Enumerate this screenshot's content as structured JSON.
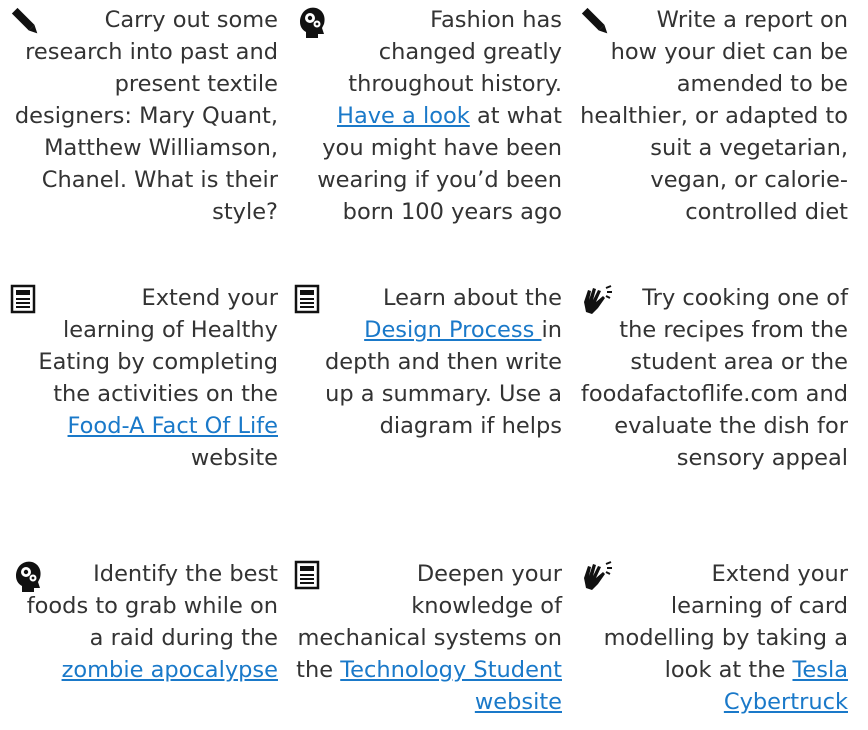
{
  "tiles": [
    {
      "icon": "pencil-icon",
      "parts": [
        {
          "text": "Carry out some research into past and present textile designers: Mary Quant, Matthew Williamson, Chanel. What is their style?"
        }
      ]
    },
    {
      "icon": "head-gears-icon",
      "parts": [
        {
          "text": "Fashion has changed greatly throughout history. "
        },
        {
          "text": "Have a look",
          "link": true
        },
        {
          "text": " at what you might have been wearing if you’d been born 100 years ago"
        }
      ]
    },
    {
      "icon": "pencil-icon",
      "parts": [
        {
          "text": "Write a report on how your diet can be amended to be healthier, or adapted to suit a vegetarian, vegan, or calorie-controlled diet"
        }
      ]
    },
    {
      "icon": "newspaper-icon",
      "parts": [
        {
          "text": "Extend your learning of Healthy Eating by completing the activities on the "
        },
        {
          "text": "Food-A Fact Of Life",
          "link": true
        },
        {
          "text": " website"
        }
      ]
    },
    {
      "icon": "newspaper-icon",
      "parts": [
        {
          "text": "Learn about the "
        },
        {
          "text": "Design Process ",
          "link": true
        },
        {
          "text": "in depth and then write up a summary. Use a diagram if helps"
        }
      ]
    },
    {
      "icon": "sign-language-hand-icon",
      "parts": [
        {
          "text": "Try cooking one of the recipes from the student area or the foodafactoflife.com and evaluate the dish for sensory appeal"
        }
      ]
    },
    {
      "icon": "head-gears-icon",
      "parts": [
        {
          "text": "Identify the best foods to grab while on a raid during the "
        },
        {
          "text": "zombie apocalypse",
          "link": true
        }
      ]
    },
    {
      "icon": "newspaper-icon",
      "parts": [
        {
          "text": "Deepen your knowledge of mechanical systems on the "
        },
        {
          "text": "Technology Student website",
          "link": true
        }
      ]
    },
    {
      "icon": "sign-language-hand-icon",
      "parts": [
        {
          "text": "Extend your learning of card modelling by taking a look at the "
        },
        {
          "text": "Tesla Cybertruck",
          "link": true
        }
      ]
    }
  ]
}
